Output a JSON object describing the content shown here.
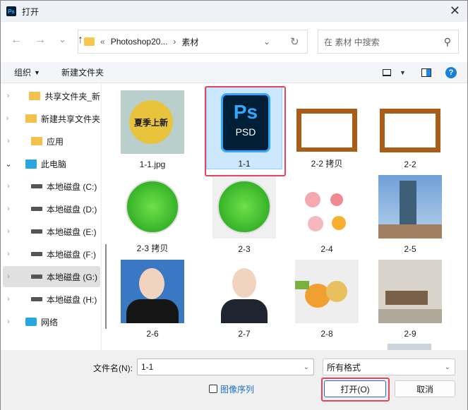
{
  "window": {
    "title": "打开",
    "close": "✕"
  },
  "address": {
    "back": "←",
    "forward": "→",
    "recent": "⌄",
    "up": "↑",
    "overflow": "«",
    "path": [
      "Photoshop20...",
      "素材"
    ],
    "sep": "›",
    "refresh": "↻",
    "dropdown": "⌄"
  },
  "search": {
    "placeholder": "在 素材 中搜索",
    "icon": "⚲"
  },
  "toolbar": {
    "organize": "组织",
    "new_folder": "新建文件夹",
    "help": "?"
  },
  "nav": [
    {
      "label": "共享文件夹_新",
      "icon": "shared-folder"
    },
    {
      "label": "新建共享文件夹",
      "icon": "shared-folder"
    },
    {
      "label": "应用",
      "icon": "folder"
    },
    {
      "label": "此电脑",
      "icon": "computer",
      "expanded": true
    },
    {
      "label": "本地磁盘 (C:)",
      "icon": "drive"
    },
    {
      "label": "本地磁盘 (D:)",
      "icon": "drive"
    },
    {
      "label": "本地磁盘 (E:)",
      "icon": "drive"
    },
    {
      "label": "本地磁盘 (F:)",
      "icon": "drive"
    },
    {
      "label": "本地磁盘 (G:)",
      "icon": "drive",
      "selected": true
    },
    {
      "label": "本地磁盘 (H:)",
      "icon": "drive"
    },
    {
      "label": "网络",
      "icon": "network"
    }
  ],
  "files": [
    {
      "name": "1-1.jpg",
      "thumb_text": "夏季上新"
    },
    {
      "name": "1-1",
      "thumb_text": "Ps",
      "thumb_sub": "PSD",
      "selected": true
    },
    {
      "name": "2-2 拷贝"
    },
    {
      "name": "2-2"
    },
    {
      "name": "2-3 拷贝"
    },
    {
      "name": "2-3"
    },
    {
      "name": "2-4"
    },
    {
      "name": "2-5"
    },
    {
      "name": "2-6"
    },
    {
      "name": "2-7"
    },
    {
      "name": "2-8"
    },
    {
      "name": "2-9"
    }
  ],
  "footer": {
    "filename_label": "文件名(N):",
    "filename_value": "1-1",
    "filter": "所有格式",
    "sequence": "图像序列",
    "open": "打开(O)",
    "cancel": "取消"
  }
}
